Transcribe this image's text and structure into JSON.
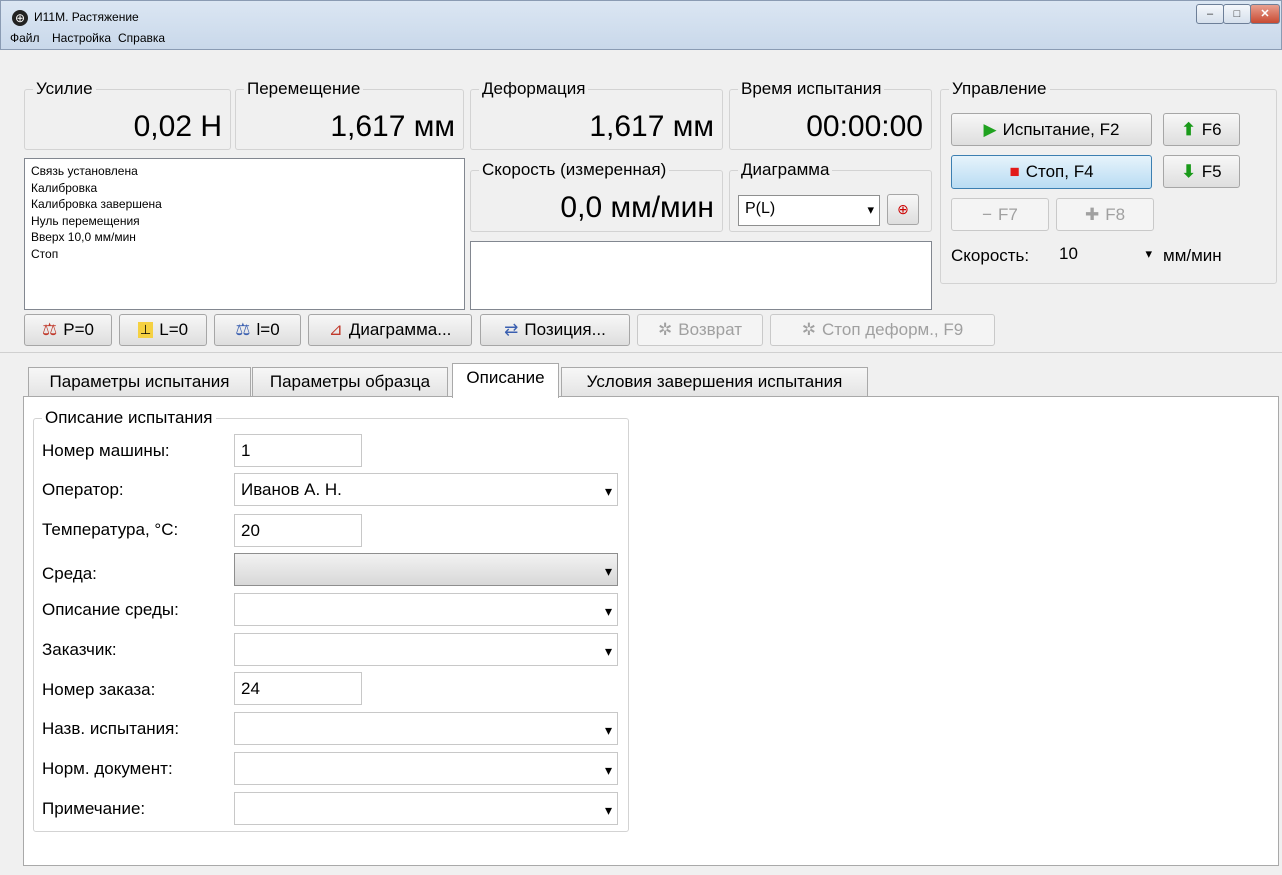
{
  "window": {
    "title": "И11М. Растяжение",
    "icon": "scales-icon",
    "controls": [
      "–",
      "□",
      "✕"
    ]
  },
  "menu": [
    "Файл",
    "Настройка",
    "Справка"
  ],
  "readouts": {
    "force": {
      "label": "Усилие",
      "value": "0,02 Н"
    },
    "displacement": {
      "label": "Перемещение",
      "value": "1,617 мм"
    },
    "deformation": {
      "label": "Деформация",
      "value": "1,617 мм"
    },
    "test_time": {
      "label": "Время испытания",
      "value": "00:00:00"
    },
    "speed_measured": {
      "label": "Скорость (измеренная)",
      "value": "0,0 мм/мин"
    }
  },
  "diagram": {
    "label": "Диаграмма",
    "selected": "P(L)"
  },
  "log": [
    "Связь установлена",
    "Калибровка",
    "Калибровка завершена",
    "Нуль перемещения",
    "Вверх 10,0 мм/мин",
    "Стоп"
  ],
  "control": {
    "label": "Управление",
    "test_button": "Испытание, F2",
    "stop_button": "Стоп, F4",
    "f6": "F6",
    "f5": "F5",
    "f7": "F7",
    "f8": "F8",
    "speed_label": "Скорость:",
    "speed_value": "10",
    "speed_unit": "мм/мин"
  },
  "toolbar": {
    "p_zero": "P=0",
    "l_zero": "L=0",
    "i_zero": "l=0",
    "diagram": "Диаграмма...",
    "position": "Позиция...",
    "return": "Возврат",
    "stop_deform": "Стоп деформ., F9"
  },
  "tabs": [
    "Параметры испытания",
    "Параметры образца",
    "Описание",
    "Условия завершения испытания"
  ],
  "active_tab": "Описание",
  "description": {
    "group_title": "Описание испытания",
    "fields": [
      {
        "label": "Номер машины:",
        "value": "1",
        "type": "text"
      },
      {
        "label": "Оператор:",
        "value": "Иванов А. Н.",
        "type": "combo"
      },
      {
        "label": "Температура, °C:",
        "value": "20",
        "type": "text"
      },
      {
        "label": "Среда:",
        "value": "",
        "type": "combo"
      },
      {
        "label": "Описание среды:",
        "value": "",
        "type": "combo"
      },
      {
        "label": "Заказчик:",
        "value": "",
        "type": "combo"
      },
      {
        "label": "Номер заказа:",
        "value": "24",
        "type": "text"
      },
      {
        "label": "Назв. испытания:",
        "value": "",
        "type": "combo"
      },
      {
        "label": "Норм. документ:",
        "value": "",
        "type": "combo"
      },
      {
        "label": "Примечание:",
        "value": "",
        "type": "combo"
      }
    ]
  },
  "colors": {
    "accent_blue": "#3c7fb1",
    "play_green": "#1fa21f",
    "stop_red": "#e21a1a",
    "arrow_green": "#1a9a1a"
  }
}
